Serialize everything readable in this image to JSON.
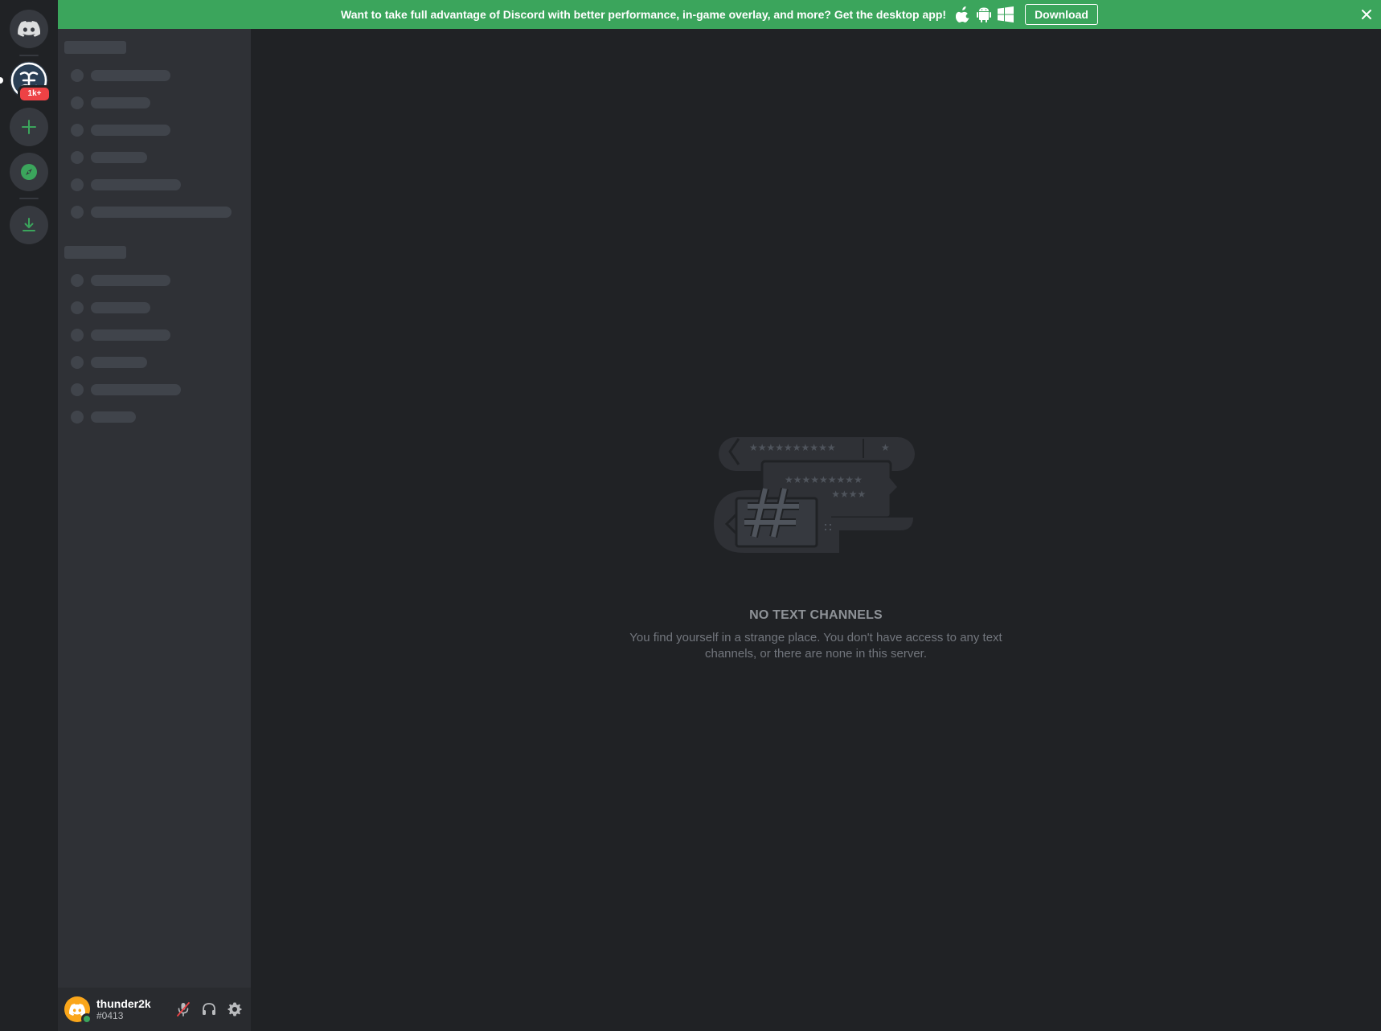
{
  "banner": {
    "message": "Want to take full advantage of Discord with better performance, in-game overlay, and more? Get the desktop app!",
    "download_label": "Download",
    "platform_icons": [
      "apple-icon",
      "android-icon",
      "windows-icon"
    ],
    "background_color": "#3ba55c"
  },
  "server_rail": {
    "home_icon": "discord-logo-icon",
    "server_badge": "1k+",
    "add_server_icon": "plus-icon",
    "explore_icon": "compass-icon",
    "download_apps_icon": "download-icon"
  },
  "empty_state": {
    "title": "NO TEXT CHANNELS",
    "description": "You find yourself in a strange place. You don't have access to any text channels, or there are none in this server."
  },
  "user_panel": {
    "username": "thunder2k",
    "discriminator": "#0413",
    "status": "online",
    "mute_icon": "microphone-muted-icon",
    "deafen_icon": "headphones-icon",
    "settings_icon": "gear-icon"
  },
  "colors": {
    "accent_green": "#3ba55c",
    "badge_red": "#ed4245",
    "avatar_orange": "#faa61a"
  }
}
